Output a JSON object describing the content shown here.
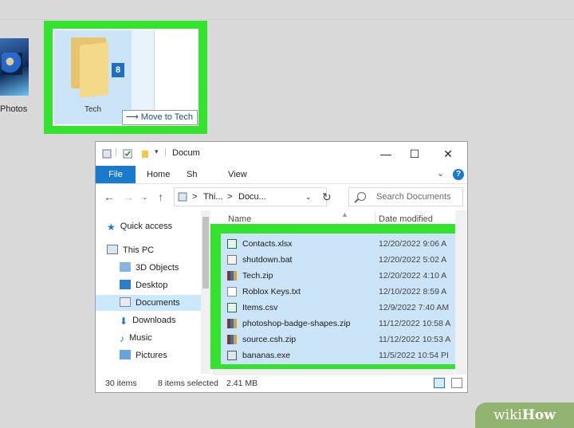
{
  "desktop": {
    "photos_label": "Photos",
    "tech_label": "Tech",
    "drag_count": "8",
    "move_tooltip": "Move to Tech"
  },
  "colors": {
    "highlight": "#33e32e",
    "selection": "#cce4f7",
    "accent": "#1979ca"
  },
  "window": {
    "title": "Docum",
    "min_glyph": "—",
    "max_glyph": "☐",
    "close_glyph": "✕",
    "ribbon": {
      "file": "File",
      "home": "Home",
      "share": "Sh",
      "view": "View"
    },
    "address": {
      "this_pc": "Thi...",
      "docs": "Docu...",
      "sep": ">"
    },
    "search_placeholder": "Search Documents",
    "columns": {
      "name": "Name",
      "date": "Date modified"
    },
    "nav": [
      {
        "label": "Quick access",
        "icon": "star-icon"
      },
      {
        "label": "This PC",
        "icon": "pc-icon"
      },
      {
        "label": "3D Objects",
        "icon": "cube-icon"
      },
      {
        "label": "Desktop",
        "icon": "desktop-icon"
      },
      {
        "label": "Documents",
        "icon": "document-icon"
      },
      {
        "label": "Downloads",
        "icon": "download-icon"
      },
      {
        "label": "Music",
        "icon": "music-icon"
      },
      {
        "label": "Pictures",
        "icon": "pictures-icon"
      }
    ],
    "files": [
      {
        "name": "Contacts.xlsx",
        "date": "12/20/2022 9:06 A",
        "icon": "excel-icon"
      },
      {
        "name": "shutdown.bat",
        "date": "12/20/2022 5:02 A",
        "icon": "batch-icon"
      },
      {
        "name": "Tech.zip",
        "date": "12/20/2022 4:10 A",
        "icon": "zip-icon"
      },
      {
        "name": "Roblox Keys.txt",
        "date": "12/10/2022 8:59 A",
        "icon": "text-icon"
      },
      {
        "name": "Items.csv",
        "date": "12/9/2022 7:40 AM",
        "icon": "excel-icon"
      },
      {
        "name": "photoshop-badge-shapes.zip",
        "date": "11/12/2022 10:58 A",
        "icon": "zip-icon"
      },
      {
        "name": "source.csh.zip",
        "date": "11/12/2022 10:53 A",
        "icon": "zip-icon"
      },
      {
        "name": "bananas.exe",
        "date": "11/5/2022 10:54 PI",
        "icon": "exe-icon"
      }
    ],
    "status": {
      "items": "30 items",
      "selected": "8 items selected",
      "size": "2.41 MB"
    }
  },
  "watermark": {
    "wiki": "wiki",
    "how": "How"
  }
}
